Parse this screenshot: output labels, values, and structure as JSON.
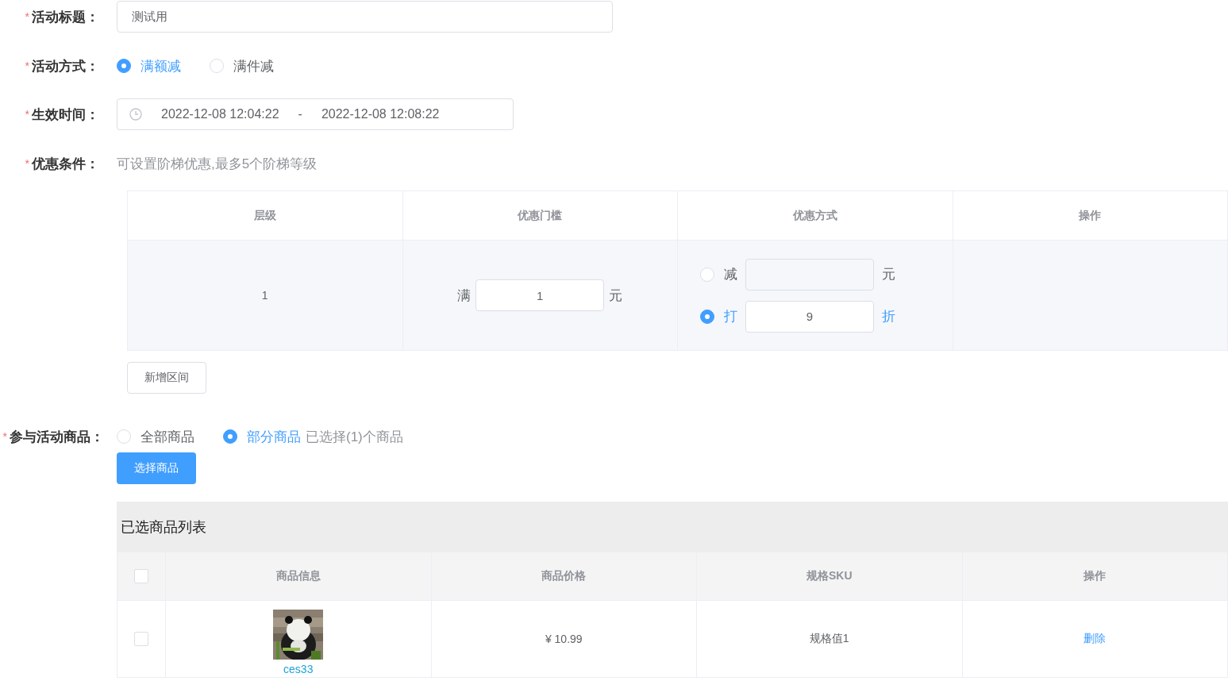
{
  "title_field": {
    "required_mark": "*",
    "label": "活动标题：",
    "value": "测试用"
  },
  "mode_field": {
    "required_mark": "*",
    "label": "活动方式：",
    "options": [
      {
        "label": "满额减",
        "selected": true
      },
      {
        "label": "满件减",
        "selected": false
      }
    ]
  },
  "time_field": {
    "required_mark": "*",
    "label": "生效时间：",
    "start": "2022-12-08 12:04:22",
    "separator": "-",
    "end": "2022-12-08 12:08:22"
  },
  "condition_field": {
    "required_mark": "*",
    "label": "优惠条件：",
    "hint": "可设置阶梯优惠,最多5个阶梯等级"
  },
  "tier_table": {
    "columns": [
      "层级",
      "优惠门槛",
      "优惠方式",
      "操作"
    ],
    "rows": [
      {
        "level": "1",
        "threshold_prefix": "满",
        "threshold_value": "1",
        "threshold_unit": "元",
        "discounts": [
          {
            "label": "减",
            "unit": "元",
            "selected": false
          },
          {
            "label": "打",
            "value": "9",
            "unit": "折",
            "selected": true
          }
        ]
      }
    ]
  },
  "add_tier_button": "新增区间",
  "products_field": {
    "required_mark": "*",
    "label": "参与活动商品：",
    "options": [
      {
        "label": "全部商品",
        "selected": false
      },
      {
        "label": "部分商品",
        "selected": true
      }
    ],
    "selection_note": "已选择(1)个商品",
    "select_button": "选择商品"
  },
  "selected_list": {
    "title": "已选商品列表",
    "header_checked": false,
    "columns": [
      "商品信息",
      "商品价格",
      "规格SKU",
      "操作"
    ],
    "rows": [
      {
        "checked": false,
        "name": "ces33",
        "price": "¥ 10.99",
        "sku": "规格值1",
        "action": "删除"
      }
    ]
  }
}
